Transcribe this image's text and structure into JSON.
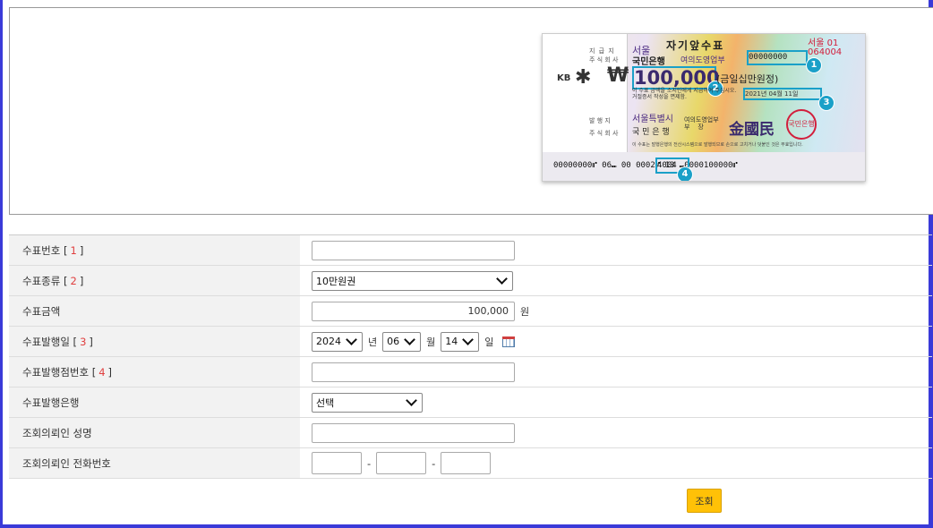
{
  "check_image": {
    "stub": {
      "kb": "KB",
      "won": "₩",
      "lbl1": "지 급 지",
      "lbl2": "주 식 회 사",
      "lbl3": "발 행 지",
      "lbl4": "주 식 회 사"
    },
    "title": "자기앞수표",
    "city": "서울",
    "bank": "국민은행",
    "branch": "여의도영업부",
    "serial": "00000000",
    "red_code": "서울 01\n064004",
    "amount": "100,000",
    "amount_korean": "(금일십만원정)",
    "note": "이 수표 금액을 소지인에게 지급하여 주십시오.\n거절증서 작성을 면제함.",
    "date": "2021년 04월 11일",
    "place": "서울특별시",
    "bank2": "국 민 은 행",
    "branch2": "여의도영업부\n부    장",
    "signature": "金國民",
    "seal": "국민은행",
    "footer": "이 수표는 발행은행의 전산시스템으로 발행되므로 손으로 고치거나 덧붙인 것은 무효입니다.",
    "micr": "00000000⑈ 06⑉      00 0002⑈ 13 ⑉0000100000⑈",
    "branch_code": "4004",
    "badges": [
      "1",
      "2",
      "3",
      "4"
    ]
  },
  "form": {
    "rows": [
      {
        "label": "수표번호",
        "num": "1"
      },
      {
        "label": "수표종류",
        "num": "2",
        "select": "10만원권"
      },
      {
        "label": "수표금액",
        "value": "100,000",
        "unit": "원"
      },
      {
        "label": "수표발행일",
        "num": "3",
        "year": "2024",
        "year_unit": "년",
        "month": "06",
        "month_unit": "월",
        "day": "14",
        "day_unit": "일"
      },
      {
        "label": "수표발행점번호",
        "num": "4"
      },
      {
        "label": "수표발행은행",
        "select": "선택"
      },
      {
        "label": "조회의뢰인 성명"
      },
      {
        "label": "조회의뢰인 전화번호",
        "sep": "-"
      }
    ]
  },
  "submit_label": "조회"
}
